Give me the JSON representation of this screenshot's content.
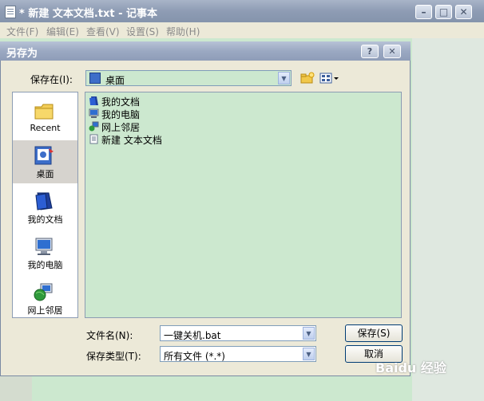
{
  "notepad": {
    "title": "* 新建 文本文档.txt - 记事本",
    "menus": [
      "文件(F)",
      "编辑(E)",
      "查看(V)",
      "设置(S)",
      "帮助(H)"
    ]
  },
  "dialog": {
    "title": "另存为",
    "help_label": "?",
    "close_label": "✕",
    "save_in_label": "保存在(I):",
    "save_in_value": "桌面",
    "places": [
      {
        "label": "Recent",
        "icon": "recent-folder-icon"
      },
      {
        "label": "桌面",
        "icon": "desktop-icon"
      },
      {
        "label": "我的文档",
        "icon": "my-documents-icon"
      },
      {
        "label": "我的电脑",
        "icon": "my-computer-icon"
      },
      {
        "label": "网上邻居",
        "icon": "network-places-icon"
      }
    ],
    "files": [
      {
        "name": "我的文档",
        "icon": "my-documents-icon"
      },
      {
        "name": "我的电脑",
        "icon": "my-computer-icon"
      },
      {
        "name": "网上邻居",
        "icon": "network-places-icon"
      },
      {
        "name": "新建 文本文档",
        "icon": "text-file-icon"
      }
    ],
    "filename_label": "文件名(N):",
    "filename_value": "一键关机.bat",
    "filetype_label": "保存类型(T):",
    "filetype_value": "所有文件 (*.*)",
    "save_button": "保存(S)",
    "cancel_button": "取消"
  },
  "watermark": "Baidu 经验",
  "colors": {
    "list_bg": "#cce8cf",
    "dialog_bg": "#ece9d8",
    "title_grad": "#9ba9c2"
  }
}
